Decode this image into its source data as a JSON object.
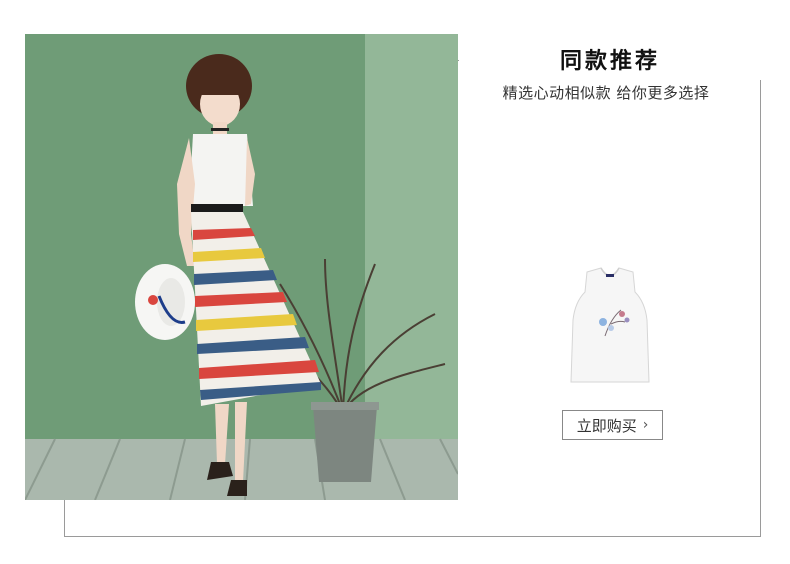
{
  "section": {
    "title": "同款推荐",
    "subtitle": "精选心动相似款 给你更多选择",
    "buy_button_label": "立即购买",
    "buy_button_chevron": "›"
  },
  "images": {
    "model_photo": "model-in-striped-skirt-photo",
    "product_photo": "white-sleeveless-top-photo"
  },
  "colors": {
    "frame_border": "#9a9a9a",
    "photo_background": "#7ea383",
    "text_primary": "#111111"
  }
}
